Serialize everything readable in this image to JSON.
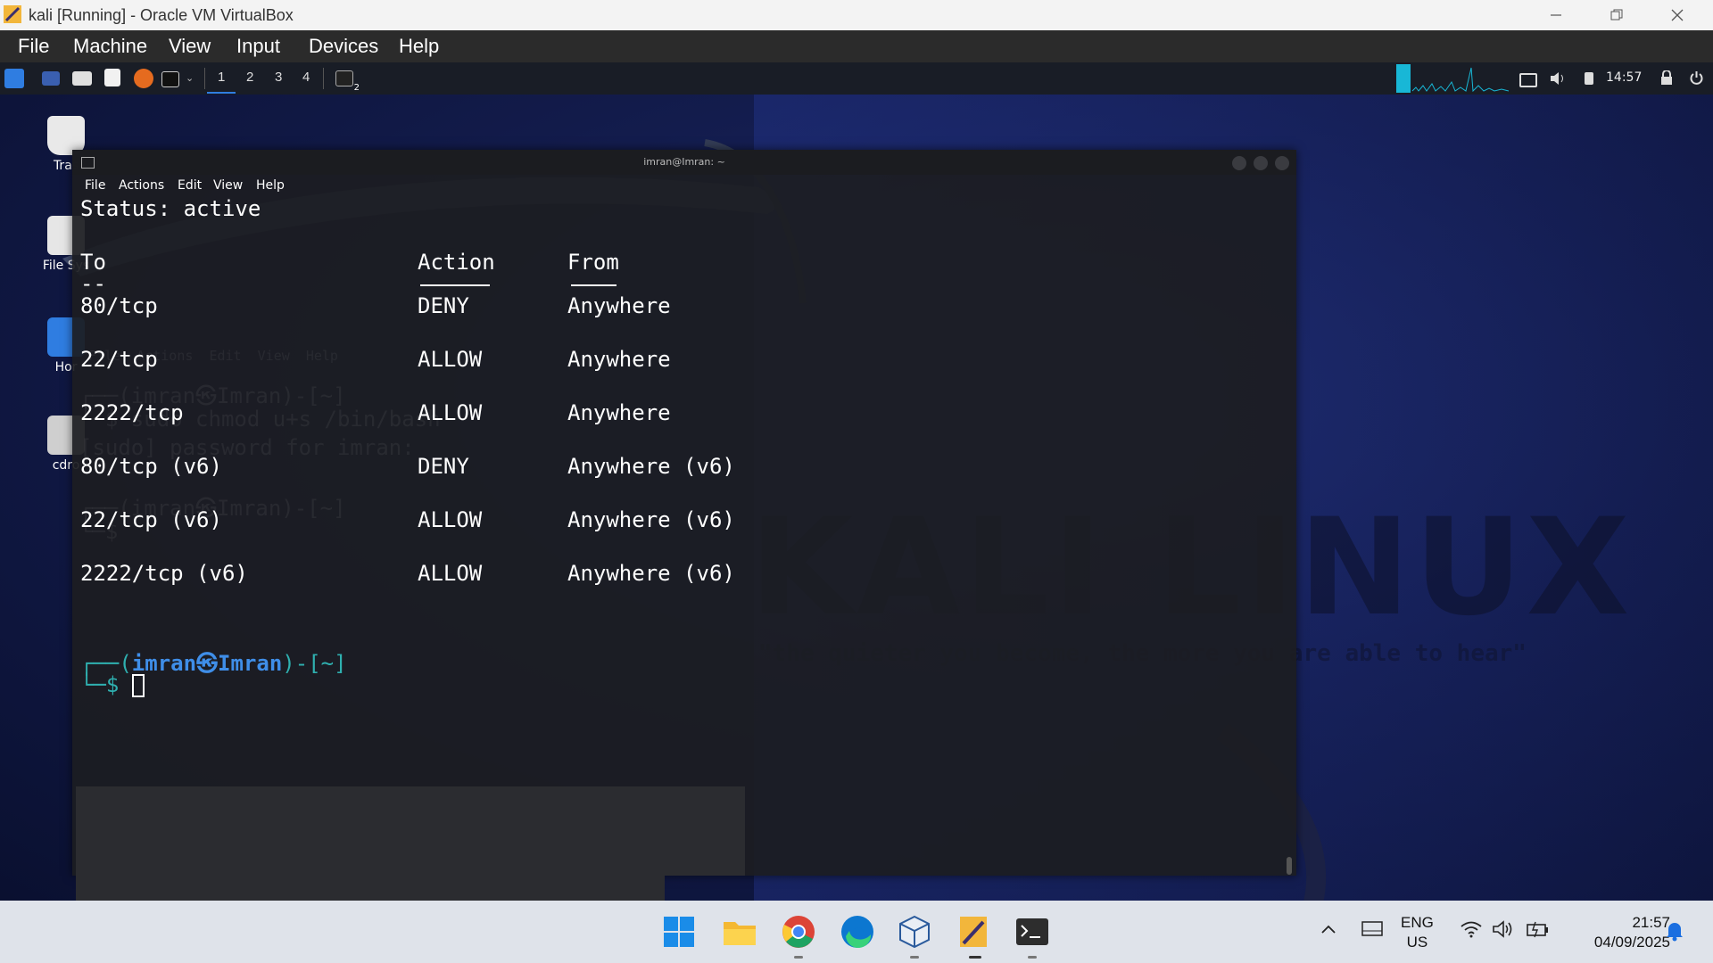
{
  "host_window": {
    "title": "kali [Running] - Oracle VM VirtualBox",
    "menu": [
      "File",
      "Machine",
      "View",
      "Input",
      "Devices",
      "Help"
    ]
  },
  "vm_panel": {
    "workspaces": [
      "1",
      "2",
      "3",
      "4"
    ],
    "clock": "14:57",
    "terminal_badge": "2"
  },
  "desktop_icons": [
    "Tras",
    "File Sys",
    "Hor",
    "cdro"
  ],
  "terminal": {
    "title": "imran@Imran: ~",
    "menu": [
      "File",
      "Actions",
      "Edit",
      "View",
      "Help"
    ],
    "status_line": "Status: active",
    "headers": {
      "to": "To",
      "action": "Action",
      "from": "From"
    },
    "header_underline_to": "--",
    "rules": [
      {
        "to": "80/tcp",
        "action": "DENY",
        "from": "Anywhere"
      },
      {
        "to": "22/tcp",
        "action": "ALLOW",
        "from": "Anywhere"
      },
      {
        "to": "2222/tcp",
        "action": "ALLOW",
        "from": "Anywhere"
      },
      {
        "to": "80/tcp (v6)",
        "action": "DENY",
        "from": "Anywhere (v6)"
      },
      {
        "to": "22/tcp (v6)",
        "action": "ALLOW",
        "from": "Anywhere (v6)"
      },
      {
        "to": "2222/tcp (v6)",
        "action": "ALLOW",
        "from": "Anywhere (v6)"
      }
    ],
    "prompt": {
      "prefix": "┌──(",
      "user": "imran㉿Imran",
      "suffix": ")-[~]",
      "line2": "└─$ "
    },
    "ghost_lines": [
      "File  Actions  Edit  View  Help",
      "┌──(imran㉿Imran)-[~]",
      "└─$ sudo chmod u+s /bin/bash",
      "[sudo] password for imran:",
      "┌──(imran㉿Imran)-[~]",
      "└─$ "
    ]
  },
  "wallpaper": {
    "logo_text": "KALI LINUX",
    "quote": "\"the quieter you become, the more you are able to hear\""
  },
  "taskbar": {
    "lang": "ENG",
    "region": "US",
    "time": "21:57",
    "date": "04/09/2025"
  },
  "colors": {
    "prompt_user": "#3f8ee8",
    "prompt_frame": "#2fb0b0"
  }
}
